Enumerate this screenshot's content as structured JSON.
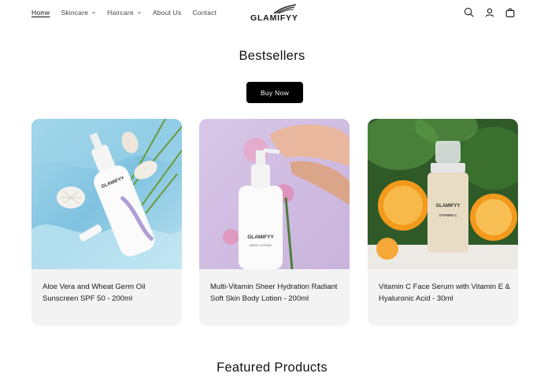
{
  "brand": {
    "logo_text": "GLAMIFYY"
  },
  "nav": {
    "home": "Home",
    "skincare": "Skincare",
    "haircare": "Haircare",
    "about": "About Us",
    "contact": "Contact"
  },
  "header_icons": [
    "search-icon",
    "account-icon",
    "cart-icon"
  ],
  "bestsellers": {
    "title": "Bestsellers",
    "button_label": "Buy Now",
    "products": [
      {
        "title": "Aloe Vera and Wheat Germ Oil Sunscreen SPF 50 - 200ml",
        "label": "GLAMIFYY"
      },
      {
        "title": "Multi-Vitamin Sheer Hydration Radiant Soft Skin Body Lotion - 200ml",
        "label": "GLAMIFYY",
        "sublabel": "BODY LOTION"
      },
      {
        "title": "Vitamin C Face Serum with Vitamin E & Hyaluronic Acid - 30ml",
        "label": "GLAMIFYY",
        "sublabel": "VITAMIN C"
      }
    ]
  },
  "featured": {
    "title": "Featured Products"
  },
  "colors": {
    "button_bg": "#000000",
    "card_bg": "#f3f3f3",
    "text": "#121212"
  }
}
